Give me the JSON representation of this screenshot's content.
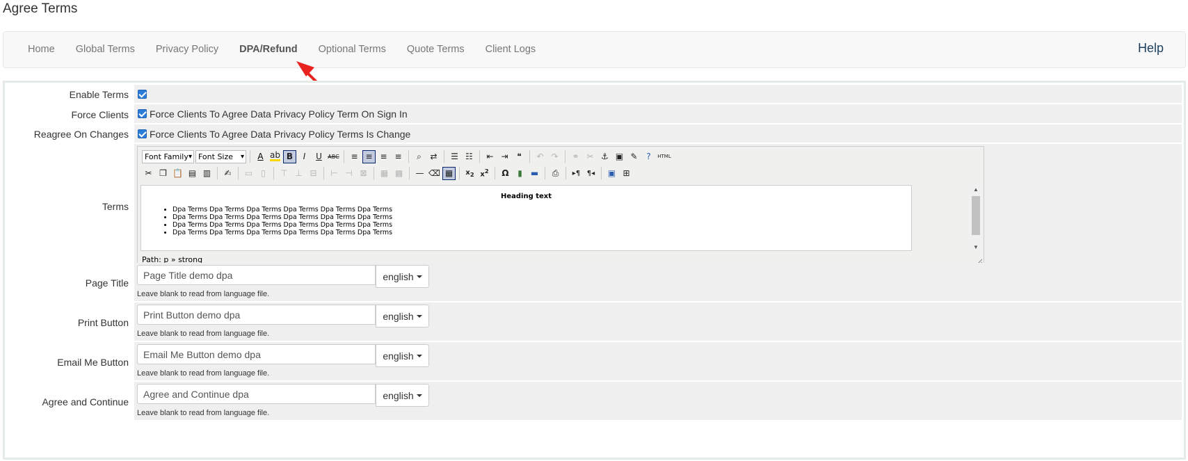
{
  "page_title": "Agree Terms",
  "nav": {
    "items": [
      {
        "label": "Home",
        "active": false
      },
      {
        "label": "Global Terms",
        "active": false
      },
      {
        "label": "Privacy Policy",
        "active": false
      },
      {
        "label": "DPA/Refund",
        "active": true
      },
      {
        "label": "Optional Terms",
        "active": false
      },
      {
        "label": "Quote Terms",
        "active": false
      },
      {
        "label": "Client Logs",
        "active": false
      }
    ],
    "help_label": "Help"
  },
  "annotation": {
    "arrow_color": "#e8231f"
  },
  "form": {
    "enable_terms": {
      "label": "Enable Terms",
      "checked": true
    },
    "force_clients": {
      "label": "Force Clients",
      "checked": true,
      "text": "Force Clients To Agree Data Privacy Policy Term On Sign In"
    },
    "reagree": {
      "label": "Reagree On Changes",
      "checked": true,
      "text": "Force Clients To Agree Data Privacy Policy Terms Is Change"
    },
    "terms": {
      "label": "Terms",
      "font_family_select": "Font Family",
      "font_size_select": "Font Size",
      "heading": "Heading text",
      "list_items": [
        "Dpa Terms Dpa Terms Dpa Terms Dpa Terms Dpa Terms Dpa Terms",
        "Dpa Terms Dpa Terms Dpa Terms Dpa Terms Dpa Terms Dpa Terms",
        "Dpa Terms Dpa Terms Dpa Terms Dpa Terms Dpa Terms Dpa Terms",
        "Dpa Terms Dpa Terms Dpa Terms Dpa Terms Dpa Terms Dpa Terms"
      ],
      "path": "Path: p » strong",
      "html_button": "HTML"
    },
    "page_title": {
      "label": "Page Title",
      "value": "Page Title demo dpa",
      "lang": "english",
      "help": "Leave blank to read from language file."
    },
    "print_button": {
      "label": "Print Button",
      "value": "Print Button demo dpa",
      "lang": "english",
      "help": "Leave blank to read from language file."
    },
    "email_button": {
      "label": "Email Me Button",
      "value": "Email Me Button demo dpa",
      "lang": "english",
      "help": "Leave blank to read from language file."
    },
    "agree_continue": {
      "label": "Agree and Continue",
      "value": "Agree and Continue dpa",
      "lang": "english",
      "help": "Leave blank to read from language file."
    }
  }
}
